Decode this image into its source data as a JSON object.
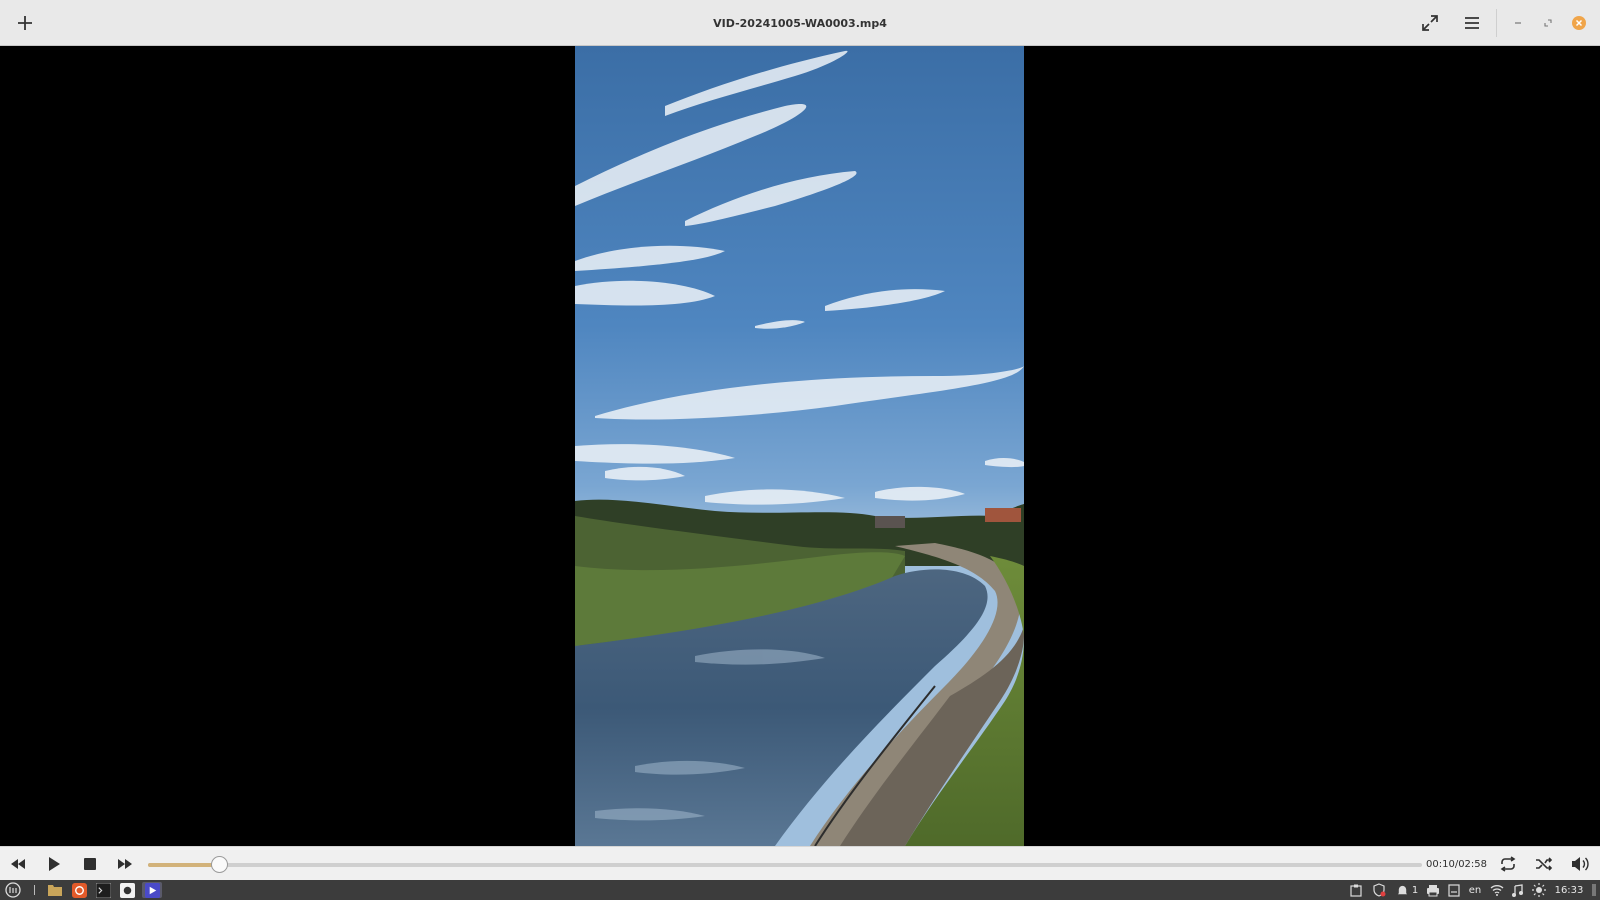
{
  "window": {
    "title": "VID-20241005-WA0003.mp4",
    "accent_color": "#d2b27a",
    "close_color": "#f0a54a"
  },
  "header": {
    "add_icon": "plus-icon",
    "fullscreen_icon": "fullscreen-icon",
    "menu_icon": "hamburger-menu-icon",
    "minimize_icon": "minimize-icon",
    "maximize_icon": "maximize-icon",
    "close_icon": "close-icon"
  },
  "video": {
    "description_icon": "video-frame"
  },
  "controls": {
    "rewind_icon": "rewind-icon",
    "play_icon": "play-icon",
    "stop_icon": "stop-icon",
    "forward_icon": "fast-forward-icon",
    "time_display": "00:10/02:58",
    "progress_fraction": 0.056,
    "repeat_icon": "repeat-icon",
    "shuffle_icon": "shuffle-icon",
    "volume_icon": "volume-icon"
  },
  "taskbar": {
    "launchers": [
      "menu-icon",
      "file-manager-icon",
      "firefox-icon",
      "terminal-icon",
      "app-icon",
      "video-player-icon"
    ],
    "notification_count": "1",
    "language": "en",
    "clock": "16:33"
  }
}
